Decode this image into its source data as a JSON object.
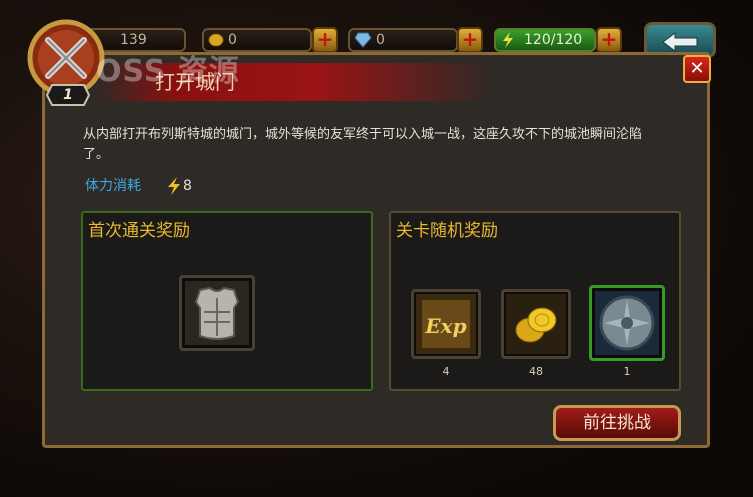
{
  "topbar": {
    "power_value": "139",
    "gold_value": "0",
    "diamond_value": "0",
    "stamina_value": "120/120",
    "player_level": "1",
    "plus": "+",
    "colors": {
      "stamina": "#3a9a28",
      "plus_button": "#e0b03a",
      "back_button": "#2a6a74"
    }
  },
  "watermark": "OSS 资源",
  "dialog": {
    "title": "打开城门",
    "close_label": "✕",
    "description": "从内部打开布列斯特城的城门，城外等候的友军终于可以入城一战，这座久攻不下的城池瞬间沦陷了。",
    "cost_label": "体力消耗",
    "cost_icon": "lightning-icon",
    "cost_value": "8",
    "first_clear": {
      "title": "首次通关奖励",
      "items": [
        {
          "icon": "chest-armor-icon"
        }
      ]
    },
    "random_reward": {
      "title": "关卡随机奖励",
      "items": [
        {
          "icon": "exp-icon",
          "count": "4",
          "exp_text": "Exp"
        },
        {
          "icon": "gold-coins-icon",
          "count": "48"
        },
        {
          "icon": "stone-orb-icon",
          "count": "1"
        }
      ]
    },
    "challenge_label": "前往挑战",
    "colors": {
      "accent_gold": "#e8b830",
      "cost_blue": "#3ea8e8",
      "title_red": "#9a1414"
    }
  }
}
